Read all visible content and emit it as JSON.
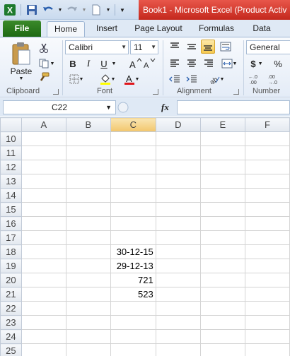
{
  "window": {
    "title": "Book1 - Microsoft Excel (Product Activ"
  },
  "tabs": {
    "file": "File",
    "home": "Home",
    "insert": "Insert",
    "page_layout": "Page Layout",
    "formulas": "Formulas",
    "data": "Data"
  },
  "ribbon": {
    "clipboard": {
      "label": "Clipboard",
      "paste": "Paste"
    },
    "font": {
      "label": "Font",
      "name": "Calibri",
      "size": "11",
      "bold": "B",
      "italic": "I",
      "underline": "U"
    },
    "alignment": {
      "label": "Alignment"
    },
    "number": {
      "label": "Number",
      "format": "General",
      "currency": "$",
      "percent": "%"
    }
  },
  "formula_bar": {
    "name_box": "C22",
    "fx": "fx",
    "formula": ""
  },
  "sheet": {
    "columns": [
      "A",
      "B",
      "C",
      "D",
      "E",
      "F"
    ],
    "rows": [
      {
        "num": "10",
        "c": ""
      },
      {
        "num": "11",
        "c": ""
      },
      {
        "num": "12",
        "c": ""
      },
      {
        "num": "13",
        "c": ""
      },
      {
        "num": "14",
        "c": ""
      },
      {
        "num": "15",
        "c": ""
      },
      {
        "num": "16",
        "c": ""
      },
      {
        "num": "17",
        "c": ""
      },
      {
        "num": "18",
        "c": "30-12-15"
      },
      {
        "num": "19",
        "c": "29-12-13"
      },
      {
        "num": "20",
        "c": "721"
      },
      {
        "num": "21",
        "c": "523"
      },
      {
        "num": "22",
        "c": ""
      },
      {
        "num": "23",
        "c": ""
      },
      {
        "num": "24",
        "c": ""
      },
      {
        "num": "25",
        "c": ""
      }
    ]
  },
  "colors": {
    "accent_green": "#1e6a14",
    "title_red": "#c4281d",
    "selection_header": "#f2c66c"
  }
}
